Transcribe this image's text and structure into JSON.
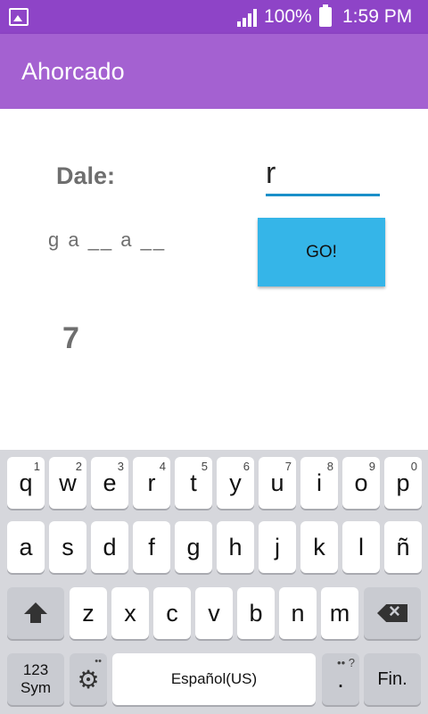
{
  "status_bar": {
    "battery_percent": "100%",
    "time": "1:59 PM",
    "icons": [
      "gallery-icon",
      "signal-icon",
      "battery-icon"
    ]
  },
  "app_bar": {
    "title": "Ahorcado"
  },
  "game": {
    "prompt_label": "Dale:",
    "letter_input_value": "r",
    "word_display": "g a __ a __",
    "go_label": "GO!",
    "attempts_left": "7"
  },
  "colors": {
    "status_bar": "#8e44c7",
    "app_bar": "#a461d1",
    "go_button": "#35b5e8",
    "input_underline": "#1a8fc9"
  },
  "keyboard": {
    "row1": [
      {
        "key": "q",
        "hint": "1"
      },
      {
        "key": "w",
        "hint": "2"
      },
      {
        "key": "e",
        "hint": "3"
      },
      {
        "key": "r",
        "hint": "4"
      },
      {
        "key": "t",
        "hint": "5"
      },
      {
        "key": "y",
        "hint": "6"
      },
      {
        "key": "u",
        "hint": "7"
      },
      {
        "key": "i",
        "hint": "8"
      },
      {
        "key": "o",
        "hint": "9"
      },
      {
        "key": "p",
        "hint": "0"
      }
    ],
    "row2": [
      "a",
      "s",
      "d",
      "f",
      "g",
      "h",
      "j",
      "k",
      "l",
      "ñ"
    ],
    "row3": [
      "z",
      "x",
      "c",
      "v",
      "b",
      "n",
      "m"
    ],
    "sym_line1": "123",
    "sym_line2": "Sym",
    "space_label": "Español(US)",
    "period_key": ".",
    "period_hint": "•• ?",
    "enter_label": "Fin."
  }
}
